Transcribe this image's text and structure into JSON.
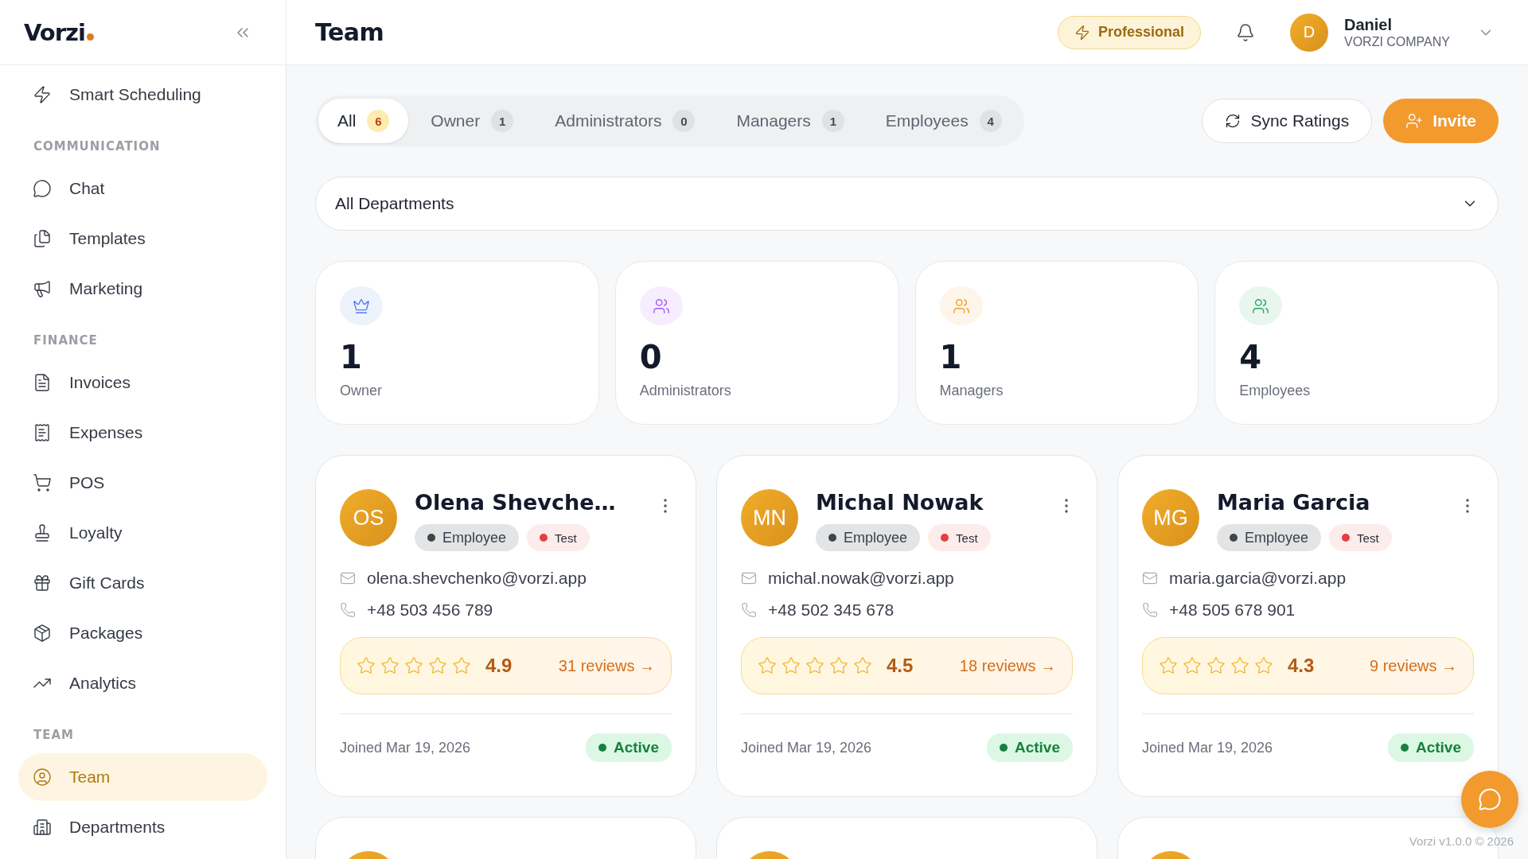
{
  "sidebar": {
    "logo": "Vorzi",
    "sections": [
      {
        "items": [
          {
            "label": "Smart Scheduling",
            "selected": false
          }
        ]
      },
      {
        "title": "COMMUNICATION",
        "items": [
          {
            "label": "Chat",
            "selected": false
          },
          {
            "label": "Templates",
            "selected": false
          },
          {
            "label": "Marketing",
            "selected": false
          }
        ]
      },
      {
        "title": "FINANCE",
        "items": [
          {
            "label": "Invoices",
            "selected": false
          },
          {
            "label": "Expenses",
            "selected": false
          },
          {
            "label": "POS",
            "selected": false
          },
          {
            "label": "Loyalty",
            "selected": false
          },
          {
            "label": "Gift Cards",
            "selected": false
          },
          {
            "label": "Packages",
            "selected": false
          },
          {
            "label": "Analytics",
            "selected": false
          }
        ]
      },
      {
        "title": "TEAM",
        "items": [
          {
            "label": "Team",
            "selected": true
          },
          {
            "label": "Departments",
            "selected": false
          }
        ]
      }
    ]
  },
  "header": {
    "title": "Team",
    "plan": "Professional",
    "user": {
      "initial": "D",
      "name": "Daniel",
      "company": "VORZI COMPANY"
    }
  },
  "tabs": [
    {
      "label": "All",
      "count": "6",
      "selected": true
    },
    {
      "label": "Owner",
      "count": "1",
      "selected": false
    },
    {
      "label": "Administrators",
      "count": "0",
      "selected": false
    },
    {
      "label": "Managers",
      "count": "1",
      "selected": false
    },
    {
      "label": "Employees",
      "count": "4",
      "selected": false
    }
  ],
  "actions": {
    "sync": "Sync Ratings",
    "invite": "Invite"
  },
  "department_filter": {
    "value": "All Departments"
  },
  "stats": [
    {
      "value": "1",
      "label": "Owner",
      "color": "#4f7cf0"
    },
    {
      "value": "0",
      "label": "Administrators",
      "color": "#a855f7"
    },
    {
      "value": "1",
      "label": "Managers",
      "color": "#f29a2e"
    },
    {
      "value": "4",
      "label": "Employees",
      "color": "#22a559"
    }
  ],
  "members": [
    {
      "initials": "OS",
      "name": "Olena Shevche…",
      "role": "Employee",
      "tag": "Test",
      "email": "olena.shevchenko@vorzi.app",
      "phone": "+48 503 456 789",
      "stars": 0,
      "rating": "4.9",
      "reviews": "31 reviews →",
      "joined": "Joined Mar 19, 2026",
      "status": "Active"
    },
    {
      "initials": "MN",
      "name": "Michal Nowak",
      "role": "Employee",
      "tag": "Test",
      "email": "michal.nowak@vorzi.app",
      "phone": "+48 502 345 678",
      "stars": 0,
      "rating": "4.5",
      "reviews": "18 reviews →",
      "joined": "Joined Mar 19, 2026",
      "status": "Active"
    },
    {
      "initials": "MG",
      "name": "Maria Garcia",
      "role": "Employee",
      "tag": "Test",
      "email": "maria.garcia@vorzi.app",
      "phone": "+48 505 678 901",
      "stars": 0,
      "rating": "4.3",
      "reviews": "9 reviews →",
      "joined": "Joined Mar 19, 2026",
      "status": "Active"
    }
  ],
  "footer": "Vorzi v1.0.0 © 2026"
}
